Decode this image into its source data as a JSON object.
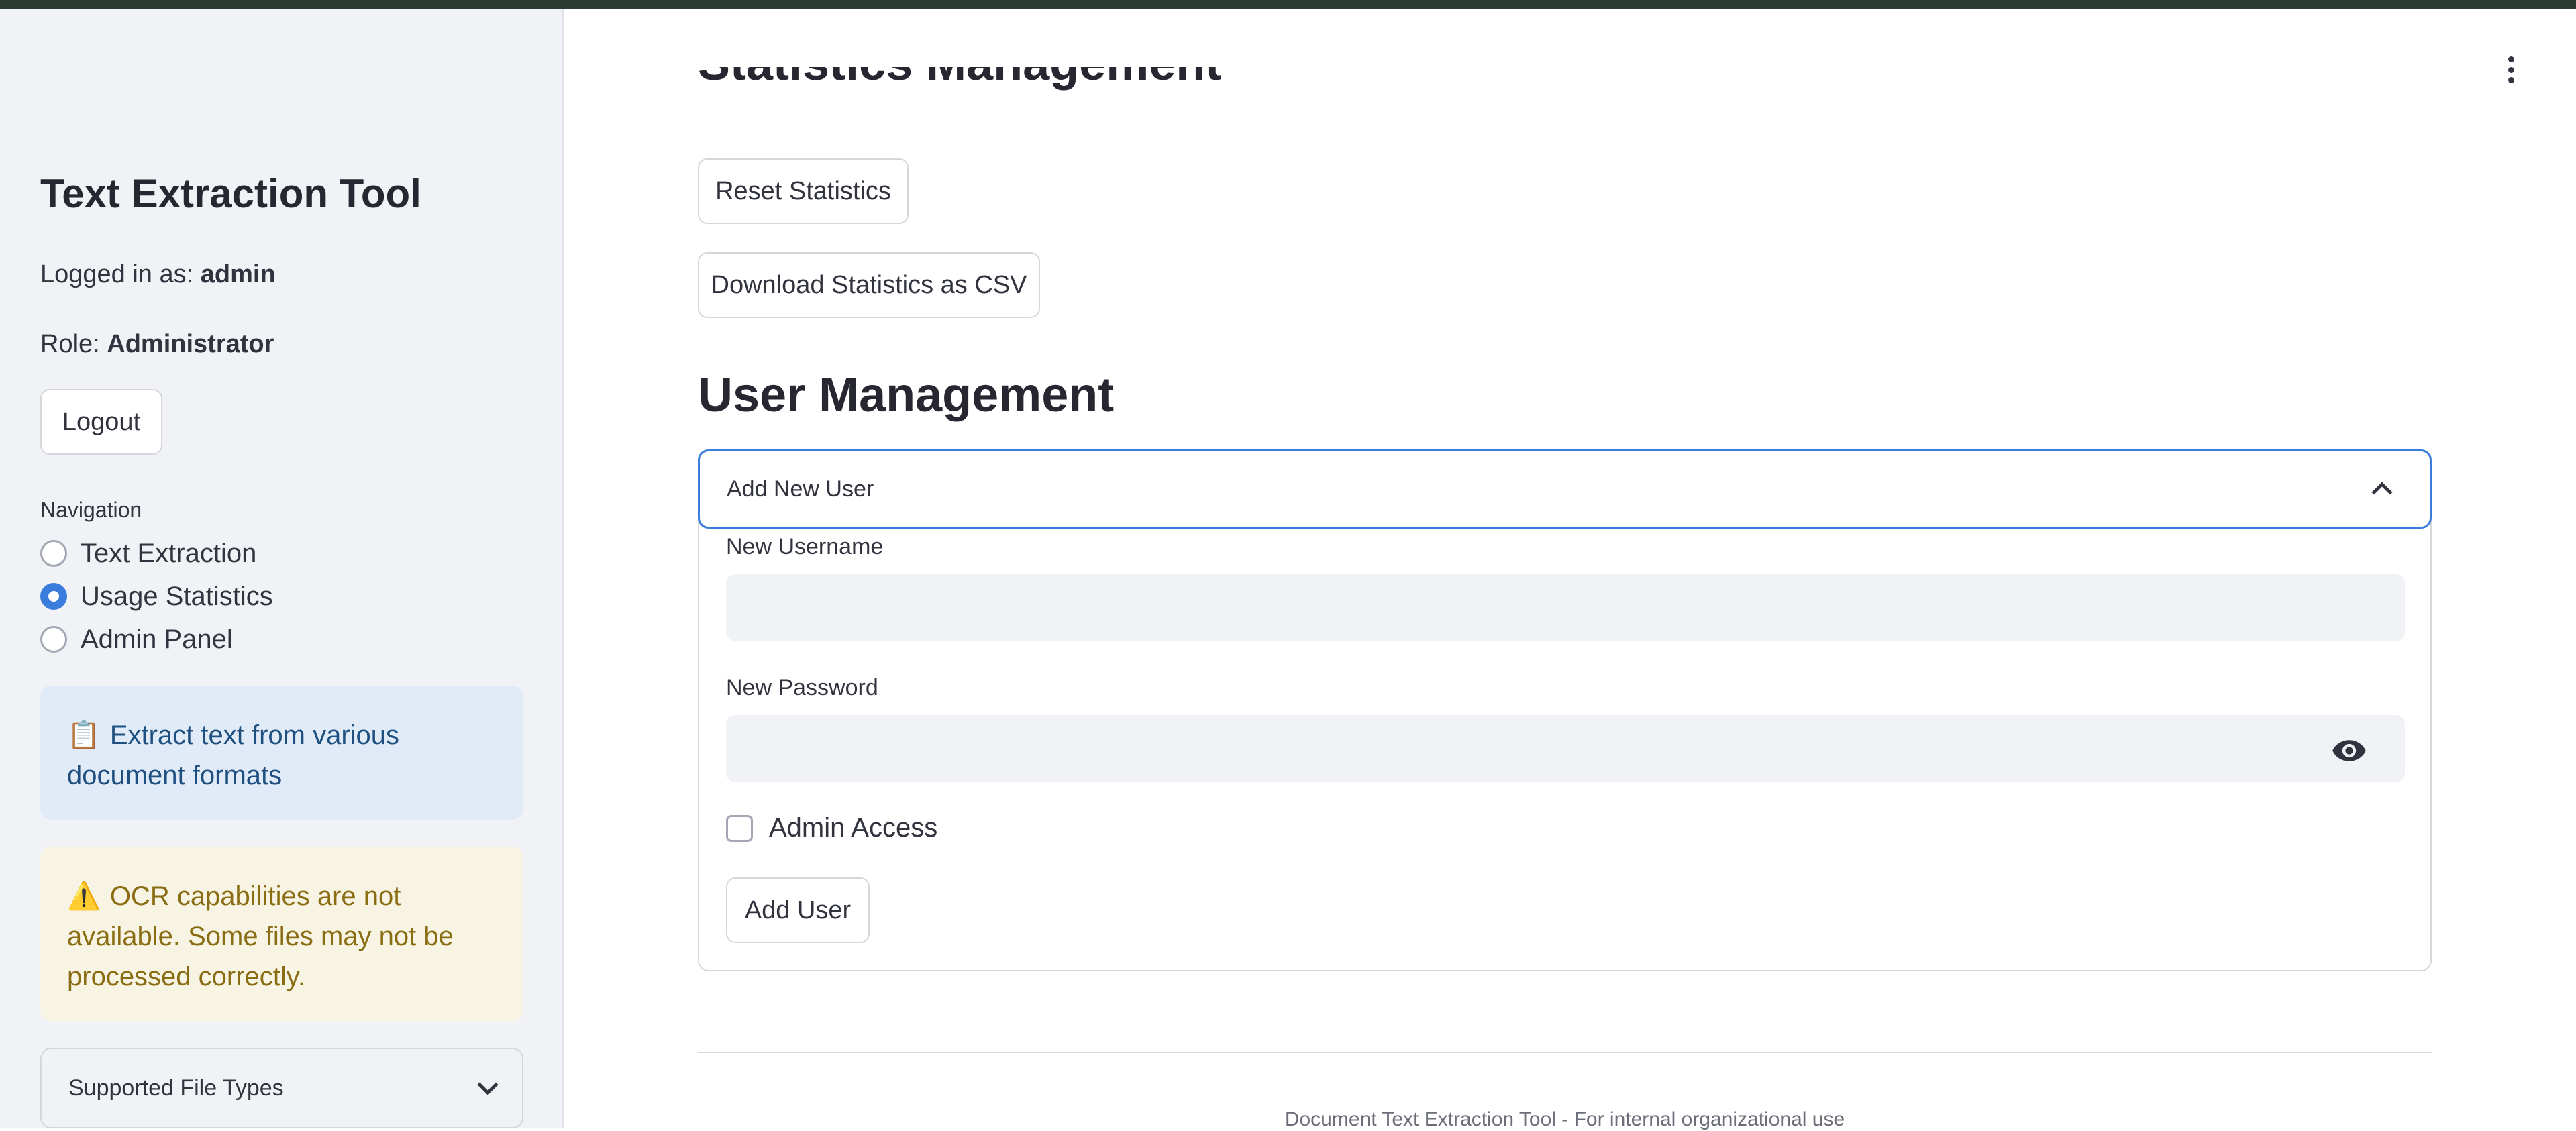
{
  "sidebar": {
    "title": "Text Extraction Tool",
    "logged_in_prefix": "Logged in as:",
    "username": "admin",
    "role_prefix": "Role:",
    "role": "Administrator",
    "logout_label": "Logout",
    "navigation_label": "Navigation",
    "nav_options": [
      {
        "label": "Text Extraction",
        "selected": false
      },
      {
        "label": "Usage Statistics",
        "selected": true
      },
      {
        "label": "Admin Panel",
        "selected": false
      }
    ],
    "info_icon": "clipboard-icon",
    "info_text": "Extract text from various document formats",
    "warning_icon": "warning-icon",
    "warning_text": "OCR capabilities are not available. Some files may not be processed correctly.",
    "supported_types_label": "Supported File Types"
  },
  "main": {
    "statistics_heading": "Statistics Management",
    "reset_button": "Reset Statistics",
    "download_button": "Download Statistics as CSV",
    "user_management_heading": "User Management",
    "add_user_expander": {
      "label": "Add New User",
      "expanded": true,
      "username_label": "New Username",
      "username_value": "",
      "password_label": "New Password",
      "password_value": "",
      "admin_access_label": "Admin Access",
      "admin_access_checked": false,
      "submit_label": "Add User"
    },
    "footer_text": "Document Text Extraction Tool - For internal organizational use"
  },
  "colors": {
    "accent": "#3b7ddd",
    "sidebar_bg": "#f0f2f6",
    "info_bg": "#e1ebf7",
    "warning_bg": "#f7f4e4",
    "topbar": "#2b3a33"
  }
}
